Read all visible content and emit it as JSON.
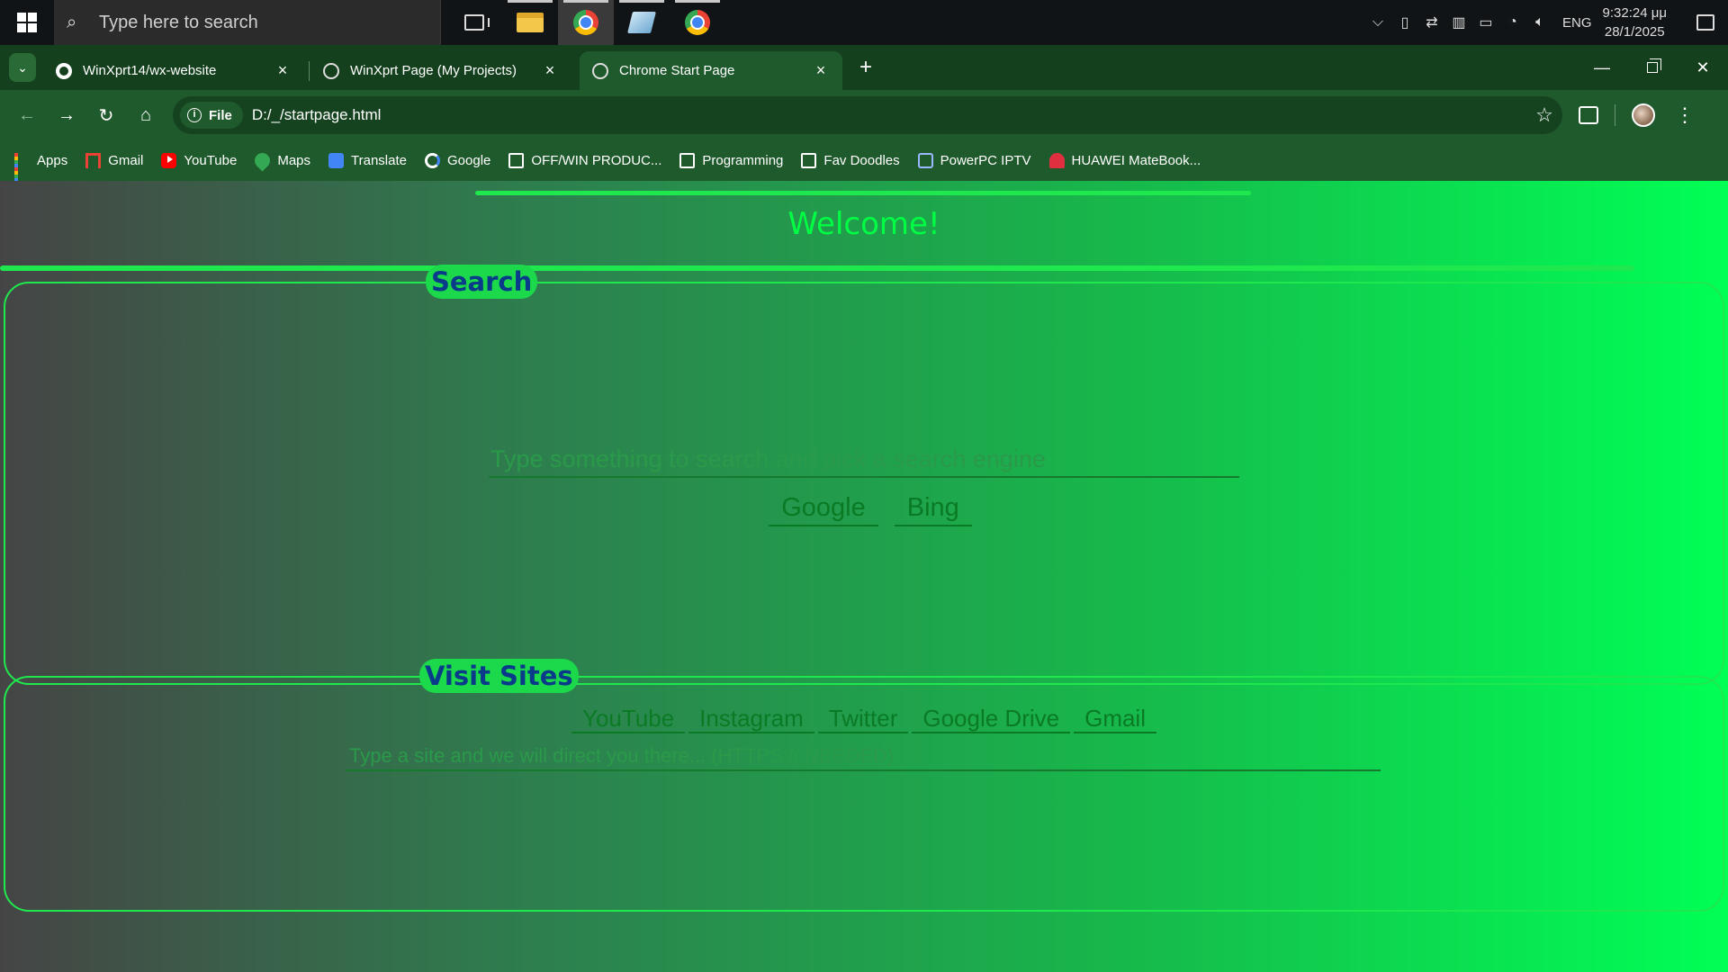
{
  "taskbar": {
    "search_placeholder": "Type here to search",
    "apps": [
      "task-view",
      "file-explorer",
      "chrome",
      "tablet-app",
      "chrome"
    ],
    "language": "ENG",
    "time": "9:32:24 μμ",
    "date": "28/1/2025"
  },
  "browser": {
    "tabs": [
      {
        "title": "WinXprt14/wx-website",
        "favicon": "github-icon",
        "active": false
      },
      {
        "title": "WinXprt Page (My Projects)",
        "favicon": "globe-icon",
        "active": false
      },
      {
        "title": "Chrome Start Page",
        "favicon": "globe-icon",
        "active": true
      }
    ],
    "new_tab": "+",
    "site_chip": "File",
    "url": "D:/_/startpage.html",
    "bookmarks": [
      {
        "label": "Apps",
        "icon": "apps-grid-icon"
      },
      {
        "label": "Gmail",
        "icon": "gmail-icon"
      },
      {
        "label": "YouTube",
        "icon": "youtube-icon"
      },
      {
        "label": "Maps",
        "icon": "maps-icon"
      },
      {
        "label": "Translate",
        "icon": "translate-icon"
      },
      {
        "label": "Google",
        "icon": "google-icon"
      },
      {
        "label": "OFF/WIN PRODUC...",
        "icon": "folder-icon"
      },
      {
        "label": "Programming",
        "icon": "folder-icon"
      },
      {
        "label": "Fav Doodles",
        "icon": "folder-icon"
      },
      {
        "label": "PowerPC IPTV",
        "icon": "powerpc-icon"
      },
      {
        "label": "HUAWEI MateBook...",
        "icon": "huawei-icon"
      }
    ]
  },
  "page": {
    "welcome": "Welcome!",
    "search_legend": "Search",
    "search_placeholder": "Type something to search and pick a search engine",
    "engines": [
      "Google",
      "Bing"
    ],
    "visit_legend": "Visit Sites",
    "sites": [
      "YouTube",
      "Instagram",
      "Twitter",
      "Google Drive",
      "Gmail"
    ],
    "site_placeholder": "Type a site and we will direct you there... (HTTPS:// NEEDED)"
  },
  "colors": {
    "accent": "#1fe84f",
    "welcome": "#00ff44",
    "legend_text": "#0a3a8a",
    "link": "#0a7a24",
    "chrome_frame": "#1f5a2c"
  }
}
